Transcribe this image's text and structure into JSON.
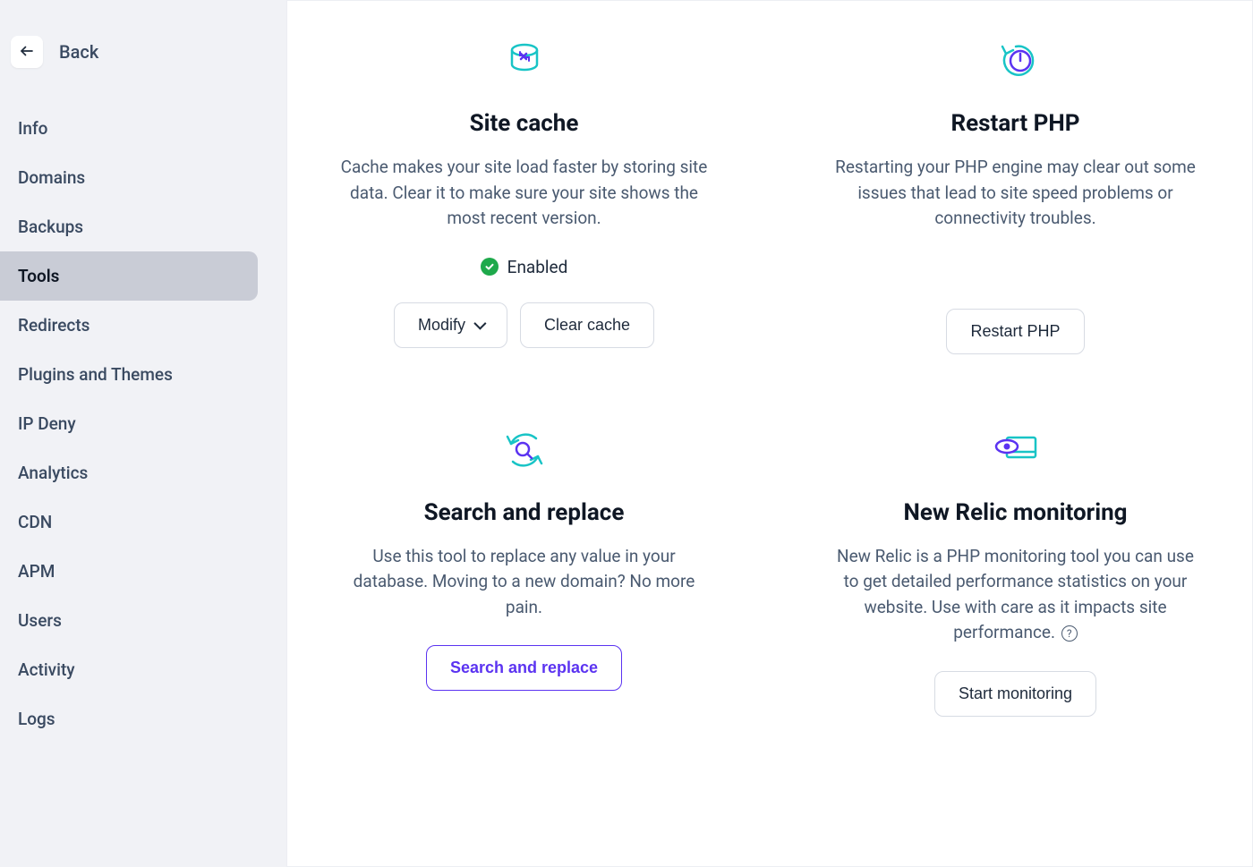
{
  "sidebar": {
    "back_label": "Back",
    "items": [
      {
        "label": "Info",
        "active": false
      },
      {
        "label": "Domains",
        "active": false
      },
      {
        "label": "Backups",
        "active": false
      },
      {
        "label": "Tools",
        "active": true
      },
      {
        "label": "Redirects",
        "active": false
      },
      {
        "label": "Plugins and Themes",
        "active": false
      },
      {
        "label": "IP Deny",
        "active": false
      },
      {
        "label": "Analytics",
        "active": false
      },
      {
        "label": "CDN",
        "active": false
      },
      {
        "label": "APM",
        "active": false
      },
      {
        "label": "Users",
        "active": false
      },
      {
        "label": "Activity",
        "active": false
      },
      {
        "label": "Logs",
        "active": false
      }
    ]
  },
  "cards": {
    "site_cache": {
      "title": "Site cache",
      "desc": "Cache makes your site load faster by storing site data. Clear it to make sure your site shows the most recent version.",
      "status": "Enabled",
      "modify_label": "Modify",
      "clear_label": "Clear cache"
    },
    "restart_php": {
      "title": "Restart PHP",
      "desc": "Restarting your PHP engine may clear out some issues that lead to site speed problems or connectivity troubles.",
      "button_label": "Restart PHP"
    },
    "search_replace": {
      "title": "Search and replace",
      "desc": "Use this tool to replace any value in your database. Moving to a new domain? No more pain.",
      "button_label": "Search and replace"
    },
    "new_relic": {
      "title": "New Relic monitoring",
      "desc": "New Relic is a PHP monitoring tool you can use to get detailed performance statistics on your website. Use with care as it impacts site performance.",
      "button_label": "Start monitoring"
    }
  }
}
